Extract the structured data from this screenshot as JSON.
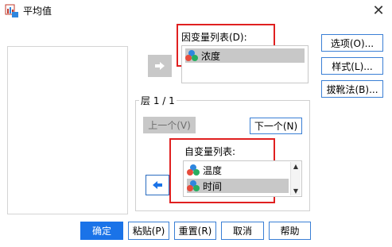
{
  "window": {
    "title": "平均值"
  },
  "dependent": {
    "label": "因变量列表(D):",
    "items": [
      {
        "label": "浓度",
        "selected": true
      }
    ]
  },
  "layer": {
    "label": "层 1 / 1",
    "prev_label": "上一个(V)",
    "next_label": "下一个(N)"
  },
  "independent": {
    "label": "自变量列表:",
    "items": [
      {
        "label": "温度",
        "selected": false
      },
      {
        "label": "时间",
        "selected": true
      }
    ]
  },
  "side_buttons": {
    "options": "选项(O)...",
    "style": "样式(L)...",
    "bootstrap": "拔靴法(B)..."
  },
  "footer": {
    "ok": "确定",
    "paste": "粘贴(P)",
    "reset": "重置(R)",
    "cancel": "取消",
    "help": "帮助"
  },
  "colors": {
    "highlight": "#e02020",
    "primary_button": "#1a73e8",
    "selected_item": "#c8c8c8"
  }
}
